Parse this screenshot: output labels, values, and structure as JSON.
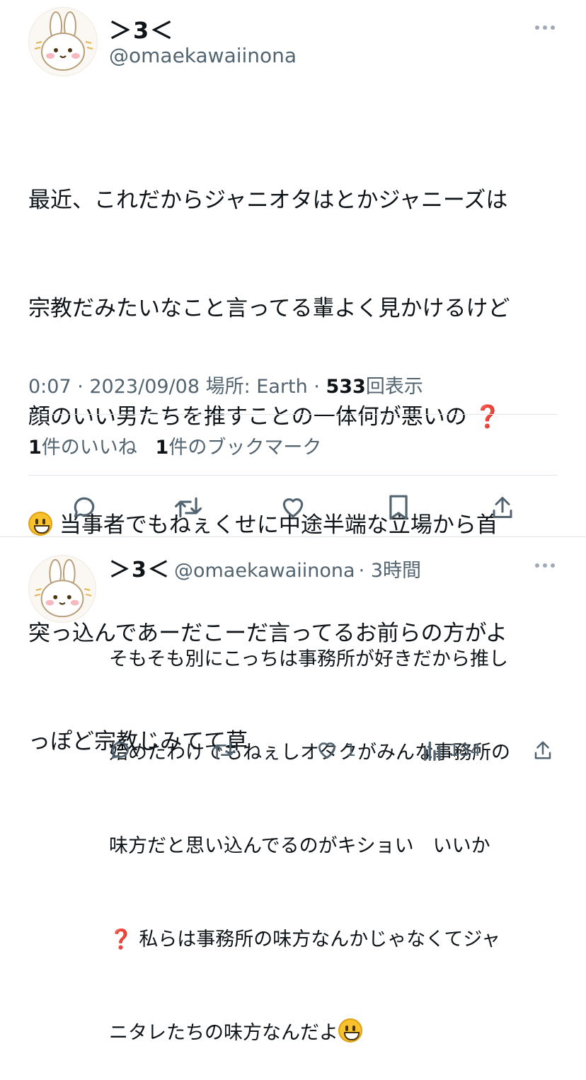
{
  "main_tweet": {
    "display_name": "＞3＜",
    "handle": "@omaekawaiinona",
    "text_lines": [
      "最近、これだからジャニオタはとかジャニーズは",
      "宗教だみたいなこと言ってる輩よく見かけるけど",
      "顔のいい男たちを推すことの一体何が悪いの"
    ],
    "text_line4": "当事者でもねぇくせに中途半端な立場から首",
    "text_line5": "突っ込んであーだこーだ言ってるお前らの方がよ",
    "text_line6": "っぽど宗教じみてて草",
    "timestamp": "0:07 · 2023/09/08",
    "location_label": "場所: Earth",
    "separator": "·",
    "views_count": "533",
    "views_label": "回表示",
    "likes_count": "1",
    "likes_label": "件のいいね",
    "bookmarks_count": "1",
    "bookmarks_label": "件のブックマーク"
  },
  "emoji": {
    "question": "❓"
  },
  "reply_tweet": {
    "display_name": "＞3＜",
    "handle": "@omaekawaiinona",
    "time": "· 3時間",
    "line1": "そもそも別にこっちは事務所が好きだから推し",
    "line2": "始めたわけでもねぇしオタクがみんな事務所の",
    "line3": "味方だと思い込んでるのがキショい　いいか",
    "line4": "私らは事務所の味方なんかじゃなくてジャ",
    "line5": "ニタレたちの味方なんだよ",
    "like_count": "1",
    "views_count": "134"
  },
  "icons": {
    "reply": "reply-icon",
    "retweet": "retweet-icon",
    "like": "heart-icon",
    "bookmark": "bookmark-icon",
    "share": "share-icon",
    "views": "views-icon",
    "more": "more-icon"
  },
  "colors": {
    "text": "#0f1419",
    "secondary": "#536471",
    "divider": "#e1e6ea",
    "emoji_red": "#e0253b"
  }
}
